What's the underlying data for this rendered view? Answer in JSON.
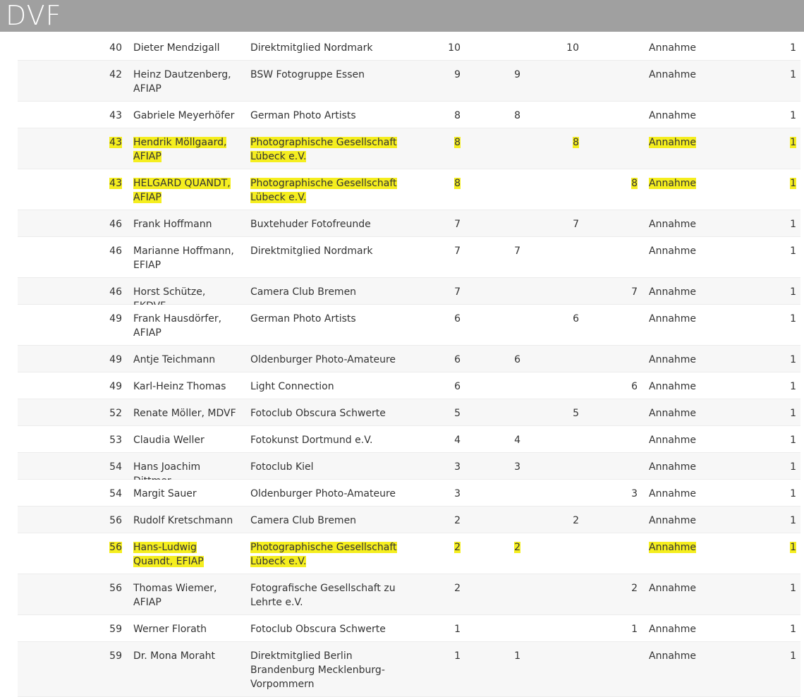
{
  "header": {
    "logo": "DVF"
  },
  "rows": [
    {
      "rank": "40",
      "name": "Dieter Mendzigall",
      "club": "Direktmitglied Nordmark",
      "c1": "10",
      "c2": "",
      "c3": "10",
      "c4": "",
      "status": "Annahme",
      "pts": "1",
      "hl": false
    },
    {
      "rank": "42",
      "name": "Heinz Dautzenberg, AFIAP",
      "club": "BSW Fotogruppe Essen",
      "c1": "9",
      "c2": "9",
      "c3": "",
      "c4": "",
      "status": "Annahme",
      "pts": "1",
      "hl": false
    },
    {
      "rank": "43",
      "name": "Gabriele Meyerhöfer",
      "club": "German Photo Artists",
      "c1": "8",
      "c2": "8",
      "c3": "",
      "c4": "",
      "status": "Annahme",
      "pts": "1",
      "hl": false
    },
    {
      "rank": "43",
      "name": "Hendrik Möllgaard, AFIAP",
      "club": "Photographische Gesellschaft Lübeck e.V.",
      "c1": "8",
      "c2": "",
      "c3": "8",
      "c4": "",
      "status": "Annahme",
      "pts": "1",
      "hl": true
    },
    {
      "rank": "43",
      "name": "HELGARD QUANDT, AFIAP",
      "club": "Photographische Gesellschaft Lübeck e.V.",
      "c1": "8",
      "c2": "",
      "c3": "",
      "c4": "8",
      "status": "Annahme",
      "pts": "1",
      "hl": true
    },
    {
      "rank": "46",
      "name": "Frank Hoffmann",
      "club": "Buxtehuder Fotofreunde",
      "c1": "7",
      "c2": "",
      "c3": "7",
      "c4": "",
      "status": "Annahme",
      "pts": "1",
      "hl": false
    },
    {
      "rank": "46",
      "name": "Marianne Hoffmann, EFIAP",
      "club": "Direktmitglied Nordmark",
      "c1": "7",
      "c2": "7",
      "c3": "",
      "c4": "",
      "status": "Annahme",
      "pts": "1",
      "hl": false
    },
    {
      "rank": "46",
      "name": "Horst Schütze, EKDVF",
      "club": "Camera Club Bremen",
      "c1": "7",
      "c2": "",
      "c3": "",
      "c4": "7",
      "status": "Annahme",
      "pts": "1",
      "hl": false
    },
    {
      "rank": "49",
      "name": "Frank Hausdörfer, AFIAP",
      "club": "German Photo Artists",
      "c1": "6",
      "c2": "",
      "c3": "6",
      "c4": "",
      "status": "Annahme",
      "pts": "1",
      "hl": false
    },
    {
      "rank": "49",
      "name": "Antje Teichmann",
      "club": "Oldenburger Photo-Amateure",
      "c1": "6",
      "c2": "6",
      "c3": "",
      "c4": "",
      "status": "Annahme",
      "pts": "1",
      "hl": false
    },
    {
      "rank": "49",
      "name": "Karl-Heinz Thomas",
      "club": "Light Connection",
      "c1": "6",
      "c2": "",
      "c3": "",
      "c4": "6",
      "status": "Annahme",
      "pts": "1",
      "hl": false
    },
    {
      "rank": "52",
      "name": "Renate Möller, MDVF",
      "club": "Fotoclub Obscura Schwerte",
      "c1": "5",
      "c2": "",
      "c3": "5",
      "c4": "",
      "status": "Annahme",
      "pts": "1",
      "hl": false
    },
    {
      "rank": "53",
      "name": "Claudia Weller",
      "club": "Fotokunst Dortmund e.V.",
      "c1": "4",
      "c2": "4",
      "c3": "",
      "c4": "",
      "status": "Annahme",
      "pts": "1",
      "hl": false
    },
    {
      "rank": "54",
      "name": "Hans Joachim Dittmer",
      "club": "Fotoclub Kiel",
      "c1": "3",
      "c2": "3",
      "c3": "",
      "c4": "",
      "status": "Annahme",
      "pts": "1",
      "hl": false
    },
    {
      "rank": "54",
      "name": "Margit Sauer",
      "club": "Oldenburger Photo-Amateure",
      "c1": "3",
      "c2": "",
      "c3": "",
      "c4": "3",
      "status": "Annahme",
      "pts": "1",
      "hl": false
    },
    {
      "rank": "56",
      "name": "Rudolf Kretschmann",
      "club": "Camera Club Bremen",
      "c1": "2",
      "c2": "",
      "c3": "2",
      "c4": "",
      "status": "Annahme",
      "pts": "1",
      "hl": false
    },
    {
      "rank": "56",
      "name": "Hans-Ludwig Quandt, EFIAP",
      "club": "Photographische Gesellschaft Lübeck e.V.",
      "c1": "2",
      "c2": "2",
      "c3": "",
      "c4": "",
      "status": "Annahme",
      "pts": "1",
      "hl": true
    },
    {
      "rank": "56",
      "name": "Thomas Wiemer, AFIAP",
      "club": "Fotografische Gesellschaft zu Lehrte e.V.",
      "c1": "2",
      "c2": "",
      "c3": "",
      "c4": "2",
      "status": "Annahme",
      "pts": "1",
      "hl": false
    },
    {
      "rank": "59",
      "name": "Werner Florath",
      "club": "Fotoclub Obscura Schwerte",
      "c1": "1",
      "c2": "",
      "c3": "",
      "c4": "1",
      "status": "Annahme",
      "pts": "1",
      "hl": false
    },
    {
      "rank": "59",
      "name": "Dr. Mona Moraht",
      "club": "Direktmitglied Berlin Brandenburg Mecklenburg-Vorpommern",
      "c1": "1",
      "c2": "1",
      "c3": "",
      "c4": "",
      "status": "Annahme",
      "pts": "1",
      "hl": false
    }
  ],
  "highlight_color": "#f5ee1f"
}
